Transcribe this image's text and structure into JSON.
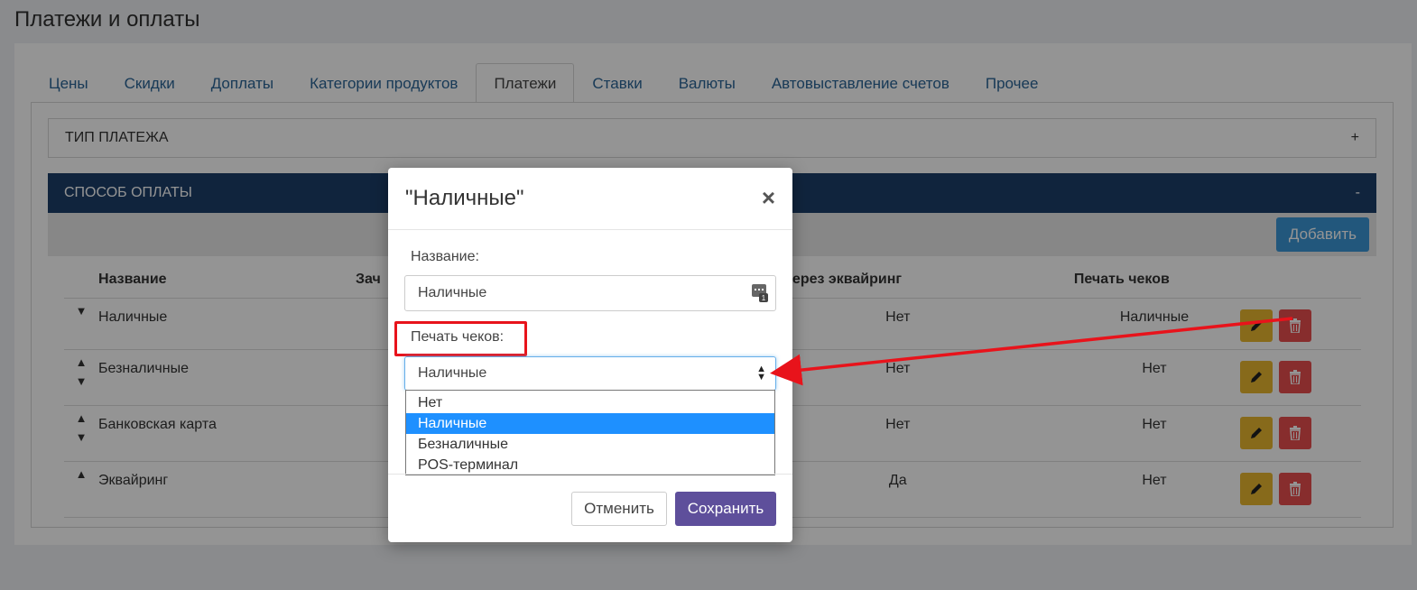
{
  "page": {
    "title": "Платежи и оплаты"
  },
  "tabs": [
    {
      "label": "Цены"
    },
    {
      "label": "Скидки"
    },
    {
      "label": "Доплаты"
    },
    {
      "label": "Категории продуктов"
    },
    {
      "label": "Платежи",
      "active": true
    },
    {
      "label": "Ставки"
    },
    {
      "label": "Валюты"
    },
    {
      "label": "Автовыставление счетов"
    },
    {
      "label": "Прочее"
    }
  ],
  "sections": {
    "payment_type": {
      "title": "ТИП ПЛАТЕЖА",
      "toggle": "+"
    },
    "payment_method": {
      "title": "СПОСОБ ОПЛАТЫ",
      "toggle": "-"
    }
  },
  "toolbar": {
    "add_label": "Добавить"
  },
  "table": {
    "headers": {
      "name": "Название",
      "zach": "Зач",
      "lc": "ение ЛС через эквайринг",
      "print": "Печать чеков"
    },
    "rows": [
      {
        "name": "Наличные",
        "lc": "Нет",
        "print": "Наличные",
        "up": false,
        "down": true
      },
      {
        "name": "Безналичные",
        "lc": "Нет",
        "print": "Нет",
        "up": true,
        "down": true
      },
      {
        "name": "Банковская карта",
        "lc": "Нет",
        "print": "Нет",
        "up": true,
        "down": true
      },
      {
        "name": "Эквайринг",
        "lc": "Да",
        "print": "Нет",
        "up": true,
        "down": false
      }
    ]
  },
  "modal": {
    "title": "\"Наличные\"",
    "close": "×",
    "name_label": "Название:",
    "name_value": "Наличные",
    "print_label": "Печать чеков:",
    "select_value": "Наличные",
    "options": [
      "Нет",
      "Наличные",
      "Безналичные",
      "POS-терминал"
    ],
    "selected_option": "Наличные",
    "cancel_label": "Отменить",
    "save_label": "Сохранить"
  },
  "colors": {
    "accent_blue": "#1c3f69",
    "add_button": "#3c96d6",
    "save_button": "#5e4f9b",
    "edit_button": "#e8b72f",
    "delete_button": "#e84e4e",
    "annotation_red": "#e8131b",
    "option_highlight": "#1e90ff"
  },
  "icons": {
    "edit": "pencil-icon",
    "delete": "trash-icon",
    "close": "close-icon",
    "select_caret": "sort-caret-icon",
    "input_widget": "input-keyboard-icon"
  }
}
